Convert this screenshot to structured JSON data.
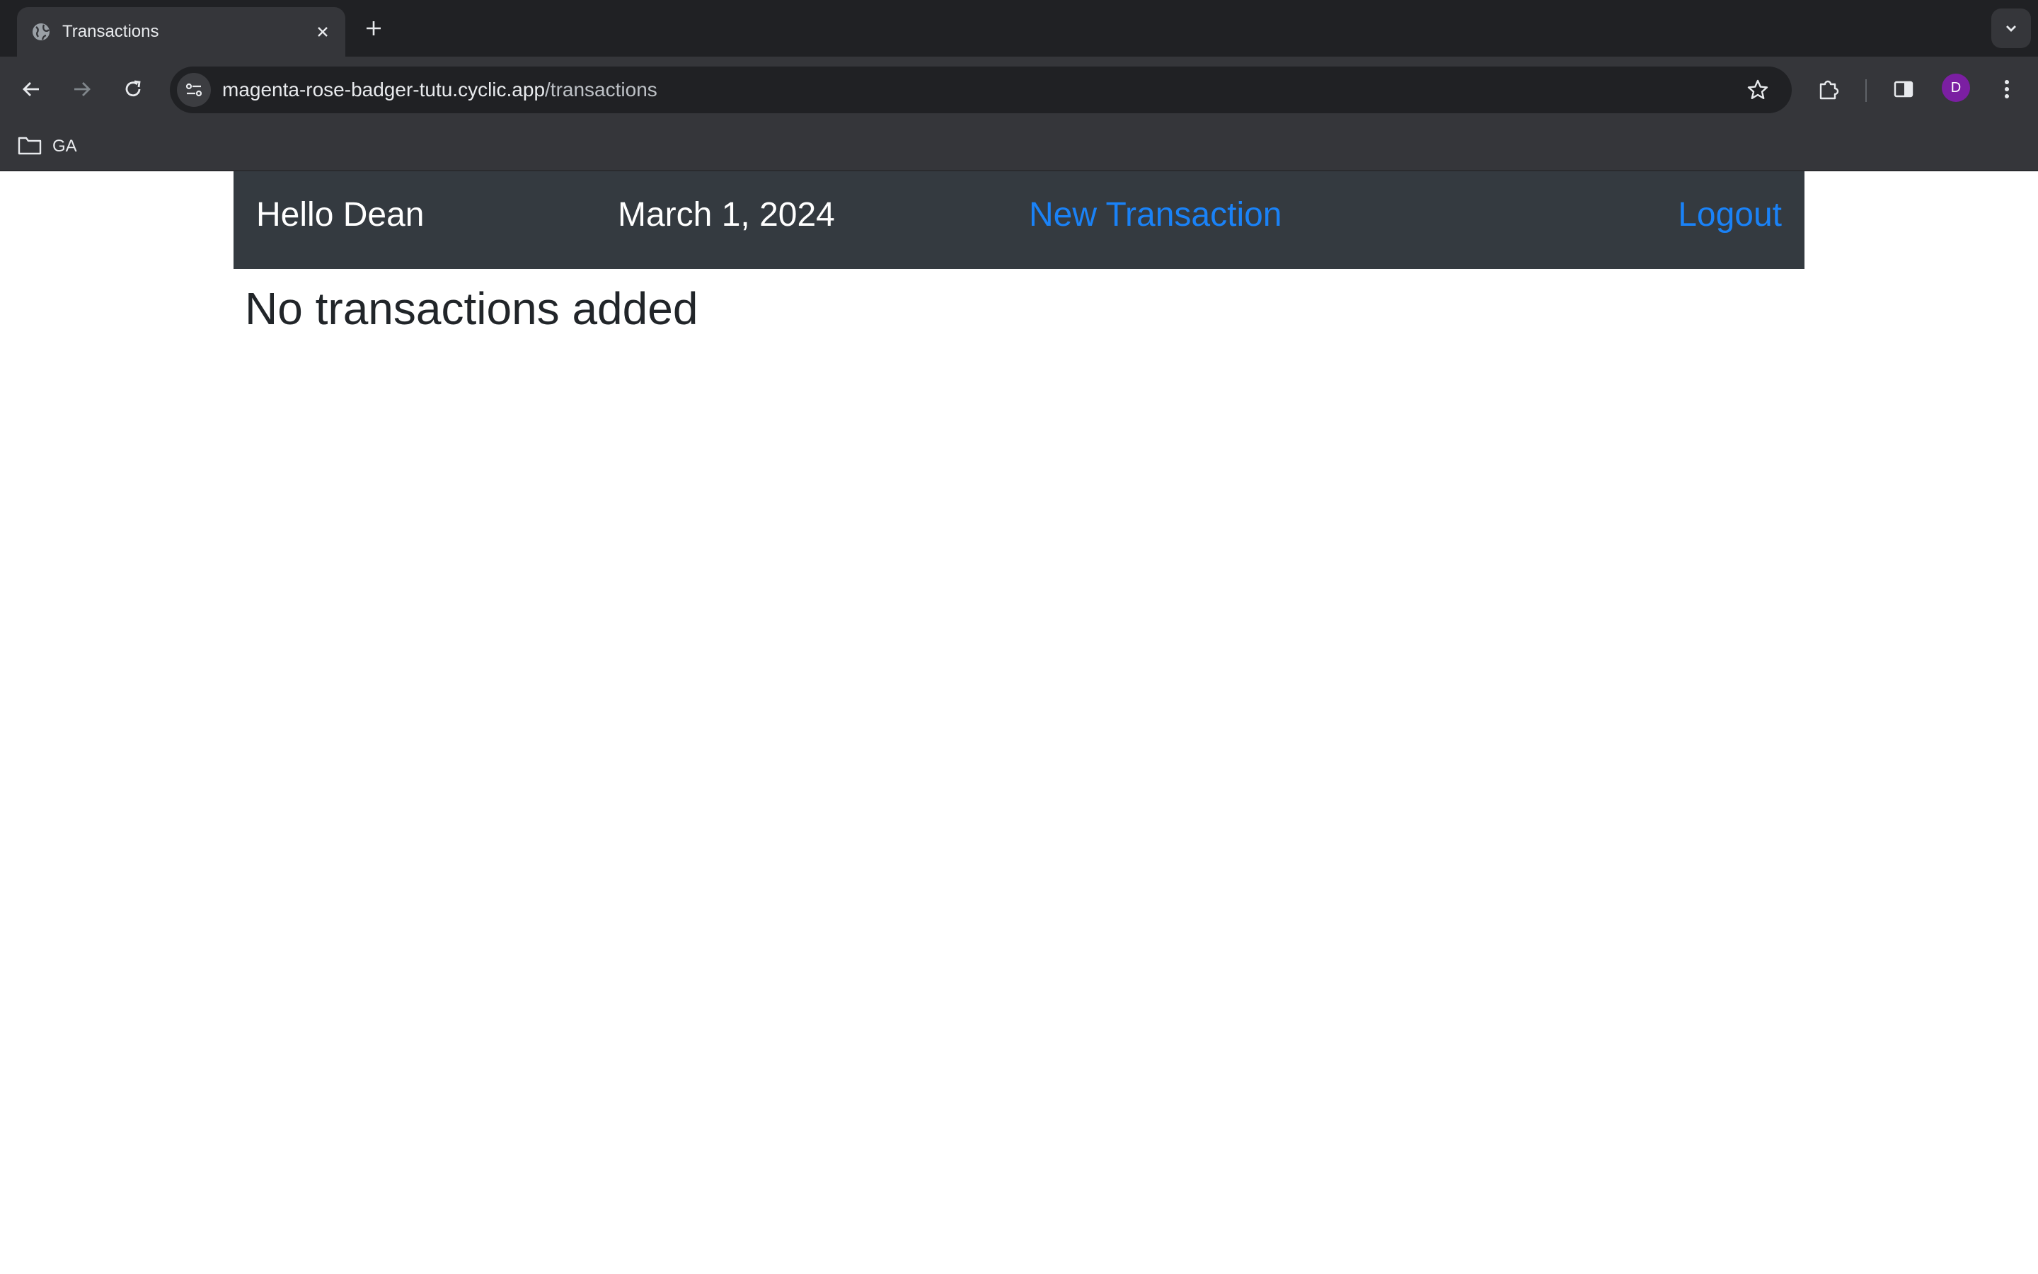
{
  "browser": {
    "tab": {
      "title": "Transactions"
    },
    "address_bar": {
      "host": "magenta-rose-badger-tutu.cyclic.app",
      "path": "/transactions"
    },
    "bookmarks": [
      {
        "label": "GA",
        "icon": "folder-icon"
      }
    ],
    "profile": {
      "initial": "D",
      "color": "#7b1fa2"
    }
  },
  "navbar": {
    "greeting": "Hello Dean",
    "date": "March 1, 2024",
    "new_transaction_link": "New Transaction",
    "logout_link": "Logout",
    "background": "#343a40",
    "link_color": "#1a82f7"
  },
  "main": {
    "empty_message": "No transactions added"
  }
}
